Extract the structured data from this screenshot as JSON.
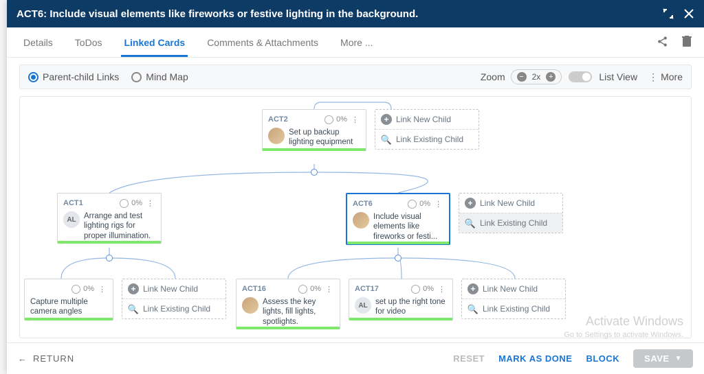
{
  "header": {
    "title": "ACT6: Include visual elements like fireworks or festive lighting in the background."
  },
  "tabs": {
    "items": [
      "Details",
      "ToDos",
      "Linked Cards",
      "Comments & Attachments",
      "More ..."
    ],
    "active_index": 2
  },
  "controls": {
    "view_options": [
      {
        "label": "Parent-child Links",
        "selected": true
      },
      {
        "label": "Mind Map",
        "selected": false
      }
    ],
    "zoom_label": "Zoom",
    "zoom_value": "2x",
    "list_view_label": "List View",
    "more_label": "More"
  },
  "link_labels": {
    "new_child": "Link New Child",
    "existing_child": "Link Existing Child"
  },
  "cards": {
    "root": {
      "id": "ACT2",
      "percent": "0%",
      "title": "Set up backup lighting equipment",
      "avatar": "img"
    },
    "left": {
      "id": "ACT1",
      "percent": "0%",
      "title": "Arrange and test lighting rigs for proper illumination.",
      "avatar": "AL"
    },
    "right": {
      "id": "ACT6",
      "percent": "0%",
      "title": "Include visual elements like fireworks or festi...",
      "avatar": "img",
      "selected": true
    },
    "l1": {
      "id": "",
      "percent": "0%",
      "title": "Capture multiple camera angles",
      "avatar": ""
    },
    "r1": {
      "id": "ACT16",
      "percent": "0%",
      "title": "Assess the key lights, fill lights, spotlights.",
      "avatar": "img"
    },
    "r2": {
      "id": "ACT17",
      "percent": "0%",
      "title": "set up the right tone for video",
      "avatar": "AL"
    }
  },
  "footer": {
    "return": "RETURN",
    "reset": "RESET",
    "done": "MARK AS DONE",
    "block": "BLOCK",
    "save": "SAVE"
  },
  "watermark": {
    "line1": "Activate Windows",
    "line2": "Go to Settings to activate Windows."
  }
}
